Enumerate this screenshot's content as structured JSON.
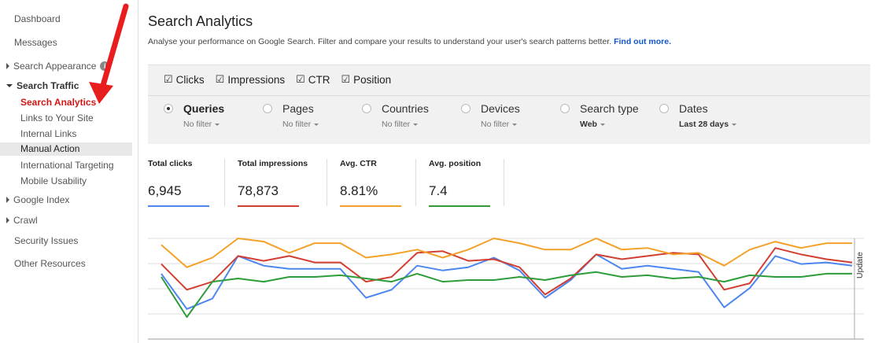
{
  "sidebar": {
    "dashboard": "Dashboard",
    "messages": "Messages",
    "search_appearance": "Search Appearance",
    "search_traffic": "Search Traffic",
    "sub_search_analytics": "Search Analytics",
    "sub_links": "Links to Your Site",
    "sub_internal_links": "Internal Links",
    "sub_manual_action": "Manual Action",
    "sub_intl_targeting": "International Targeting",
    "sub_mobile_usability": "Mobile Usability",
    "google_index": "Google Index",
    "crawl": "Crawl",
    "security_issues": "Security Issues",
    "other_resources": "Other Resources",
    "info_glyph": "i"
  },
  "main": {
    "title": "Search Analytics",
    "subtitle": "Analyse your performance on Google Search. Filter and compare your results to understand your user's search patterns better.",
    "find_out_more": "Find out more."
  },
  "metrics_toggle": [
    {
      "label": "Clicks",
      "checked": true
    },
    {
      "label": "Impressions",
      "checked": true
    },
    {
      "label": "CTR",
      "checked": true
    },
    {
      "label": "Position",
      "checked": true
    }
  ],
  "dimensions": [
    {
      "label": "Queries",
      "sub": "No filter",
      "selected": true
    },
    {
      "label": "Pages",
      "sub": "No filter",
      "selected": false
    },
    {
      "label": "Countries",
      "sub": "No filter",
      "selected": false
    },
    {
      "label": "Devices",
      "sub": "No filter",
      "selected": false
    },
    {
      "label": "Search type",
      "sub": "Web",
      "selected": false
    },
    {
      "label": "Dates",
      "sub": "Last 28 days",
      "selected": false
    }
  ],
  "cards": [
    {
      "title": "Total clicks",
      "value": "6,945",
      "color": "#4d86f0"
    },
    {
      "title": "Total impressions",
      "value": "78,873",
      "color": "#d23f31"
    },
    {
      "title": "Avg. CTR",
      "value": "8.81%",
      "color": "#f4a12a"
    },
    {
      "title": "Avg. position",
      "value": "7.4",
      "color": "#2e9c3b"
    }
  ],
  "chart": {
    "update_label": "Update"
  },
  "chart_data": {
    "type": "line",
    "series": [
      {
        "name": "Total clicks",
        "color": "#4d86f0",
        "values": [
          0.56,
          0.12,
          0.25,
          0.78,
          0.66,
          0.62,
          0.62,
          0.62,
          0.26,
          0.36,
          0.66,
          0.6,
          0.64,
          0.76,
          0.6,
          0.26,
          0.48,
          0.8,
          0.62,
          0.66,
          0.62,
          0.58,
          0.14,
          0.38,
          0.78,
          0.68,
          0.7,
          0.66
        ]
      },
      {
        "name": "Total impressions",
        "color": "#d23f31",
        "values": [
          0.68,
          0.36,
          0.46,
          0.78,
          0.72,
          0.78,
          0.7,
          0.7,
          0.46,
          0.52,
          0.82,
          0.84,
          0.72,
          0.74,
          0.64,
          0.3,
          0.5,
          0.8,
          0.74,
          0.78,
          0.82,
          0.8,
          0.36,
          0.44,
          0.88,
          0.8,
          0.74,
          0.7
        ]
      },
      {
        "name": "Avg. CTR",
        "color": "#f4a12a",
        "values": [
          0.92,
          0.64,
          0.76,
          1.0,
          0.96,
          0.82,
          0.94,
          0.94,
          0.76,
          0.8,
          0.86,
          0.76,
          0.86,
          1.0,
          0.94,
          0.86,
          0.86,
          1.0,
          0.86,
          0.88,
          0.8,
          0.82,
          0.66,
          0.86,
          0.96,
          0.88,
          0.94,
          0.94
        ]
      },
      {
        "name": "Avg. position",
        "color": "#2e9c3b",
        "values": [
          0.52,
          0.02,
          0.46,
          0.5,
          0.46,
          0.52,
          0.52,
          0.54,
          0.5,
          0.46,
          0.56,
          0.46,
          0.48,
          0.48,
          0.52,
          0.48,
          0.54,
          0.58,
          0.52,
          0.54,
          0.5,
          0.52,
          0.46,
          0.54,
          0.52,
          0.52,
          0.56,
          0.56
        ]
      }
    ]
  }
}
